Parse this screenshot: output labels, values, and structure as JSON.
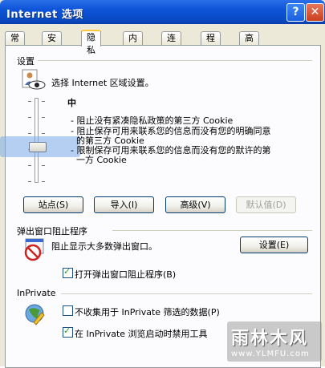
{
  "window": {
    "title": "Internet 选项",
    "help_glyph": "?",
    "close_glyph": "✕"
  },
  "tabs": [
    {
      "label": "常规"
    },
    {
      "label": "安全"
    },
    {
      "label": "隐私",
      "active": true
    },
    {
      "label": "内容"
    },
    {
      "label": "连接"
    },
    {
      "label": "程序"
    },
    {
      "label": "高级"
    }
  ],
  "settings": {
    "group_label": "设置",
    "zone_text": "选择 Internet 区域设置。",
    "level": "中",
    "descriptions": [
      "- 阻止没有紧凑隐私政策的第三方 Cookie",
      "- 阻止保存可用来联系您的信息而没有您的明确同意",
      "  的第三方 Cookie",
      "- 限制保存可用来联系您的信息而没有您的默许的第",
      "  一方 Cookie"
    ],
    "buttons": {
      "sites": "站点(S)",
      "import": "导入(I)",
      "advanced": "高级(V)",
      "default": "默认值(D)"
    }
  },
  "popup": {
    "group_label": "弹出窗口阻止程序",
    "description": "阻止显示大多数弹出窗口。",
    "settings_button": "设置(E)",
    "enable_label": "打开弹出窗口阻止程序(B)",
    "enable_checked": true
  },
  "inprivate": {
    "group_label": "InPrivate",
    "no_collect_label": "不收集用于 InPrivate 筛选的数据(P)",
    "no_collect_checked": false,
    "disable_toolbars_label": "在 InPrivate 浏览启动时禁用工具",
    "disable_toolbars_checked": true
  },
  "watermark": {
    "title": "雨林木风",
    "url": "www.YLMFU.com"
  }
}
